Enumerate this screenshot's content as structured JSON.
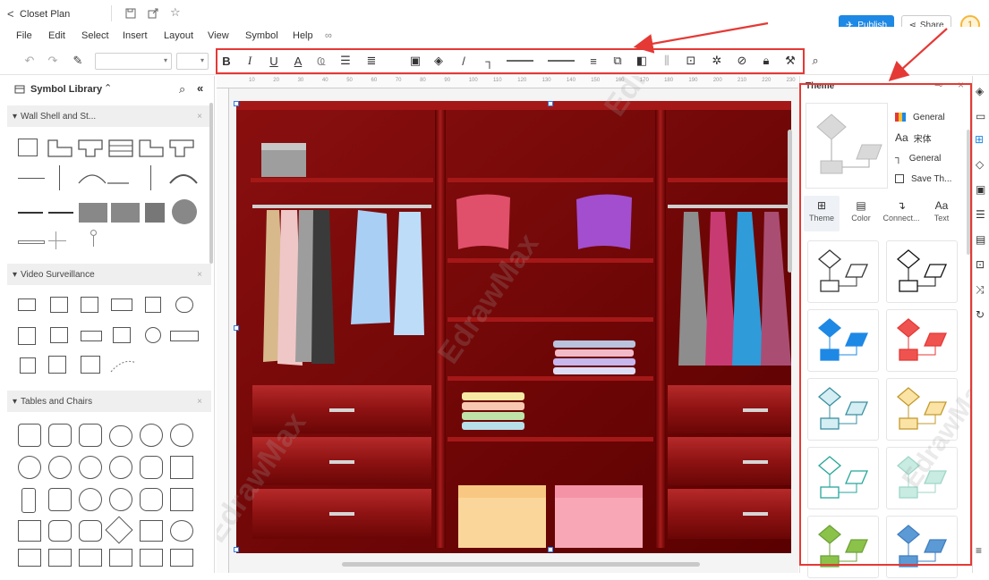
{
  "app": {
    "back_label": "<",
    "doc_title": "Closet Plan",
    "publish_label": "Publish",
    "share_label": "Share",
    "user_badge": "1"
  },
  "menu": [
    "File",
    "Edit",
    "Select",
    "Insert",
    "Layout",
    "View",
    "Symbol",
    "Help"
  ],
  "toolbar": {
    "bold": "B",
    "italic": "I",
    "underline": "U",
    "font_color": "A"
  },
  "symbol_library": {
    "title": "Symbol Library",
    "sections": [
      {
        "name": "Wall Shell and St...",
        "close": "×"
      },
      {
        "name": "Video Surveillance",
        "close": "×"
      },
      {
        "name": "Tables and Chairs",
        "close": "×"
      }
    ]
  },
  "ruler_ticks": [
    "10",
    "20",
    "30",
    "40",
    "50",
    "60",
    "70",
    "80",
    "90",
    "100",
    "110",
    "120",
    "130",
    "140",
    "150",
    "160",
    "170",
    "180",
    "190",
    "200",
    "210",
    "220",
    "230"
  ],
  "theme_panel": {
    "title": "Theme",
    "options": [
      {
        "icon": "grid-icon",
        "label": "General"
      },
      {
        "icon": "font-icon",
        "label": "宋体"
      },
      {
        "icon": "connector-icon",
        "label": "General"
      },
      {
        "icon": "save-icon",
        "label": "Save Th..."
      }
    ],
    "tabs": [
      {
        "label": "Theme",
        "glyph": "⊞"
      },
      {
        "label": "Color",
        "glyph": "▤"
      },
      {
        "label": "Connect...",
        "glyph": "↴"
      },
      {
        "label": "Text",
        "glyph": "Aa"
      }
    ],
    "font_glyph": "Aa",
    "cards": [
      {
        "fill": "#ffffff",
        "stroke": "#333333",
        "accent": "#ffffff"
      },
      {
        "fill": "#ffffff",
        "stroke": "#111111",
        "accent": "#ffffff"
      },
      {
        "fill": "#1e88e5",
        "stroke": "#1e88e5",
        "accent": "#1e88e5"
      },
      {
        "fill": "#ef5350",
        "stroke": "#e53935",
        "accent": "#ef5350"
      },
      {
        "fill": "#d4eef3",
        "stroke": "#3a8fa0",
        "accent": "#d4eef3"
      },
      {
        "fill": "#fbe3a5",
        "stroke": "#c29a2e",
        "accent": "#fbe3a5"
      },
      {
        "fill": "#ffffff",
        "stroke": "#26a69a",
        "accent": "#ffffff"
      },
      {
        "fill": "#c8ebe2",
        "stroke": "#9fd6c8",
        "accent": "#c8ebe2"
      },
      {
        "fill": "#8bc34a",
        "stroke": "#6ea13a",
        "accent": "#8bc34a"
      },
      {
        "fill": "#5c9ad6",
        "stroke": "#3f7fc0",
        "accent": "#5c9ad6"
      }
    ]
  },
  "colors": {
    "accent_blue": "#1e88e5",
    "annotation_red": "#e53935",
    "closet_dark": "#6b0000",
    "closet_mid": "#8e0c0c"
  }
}
